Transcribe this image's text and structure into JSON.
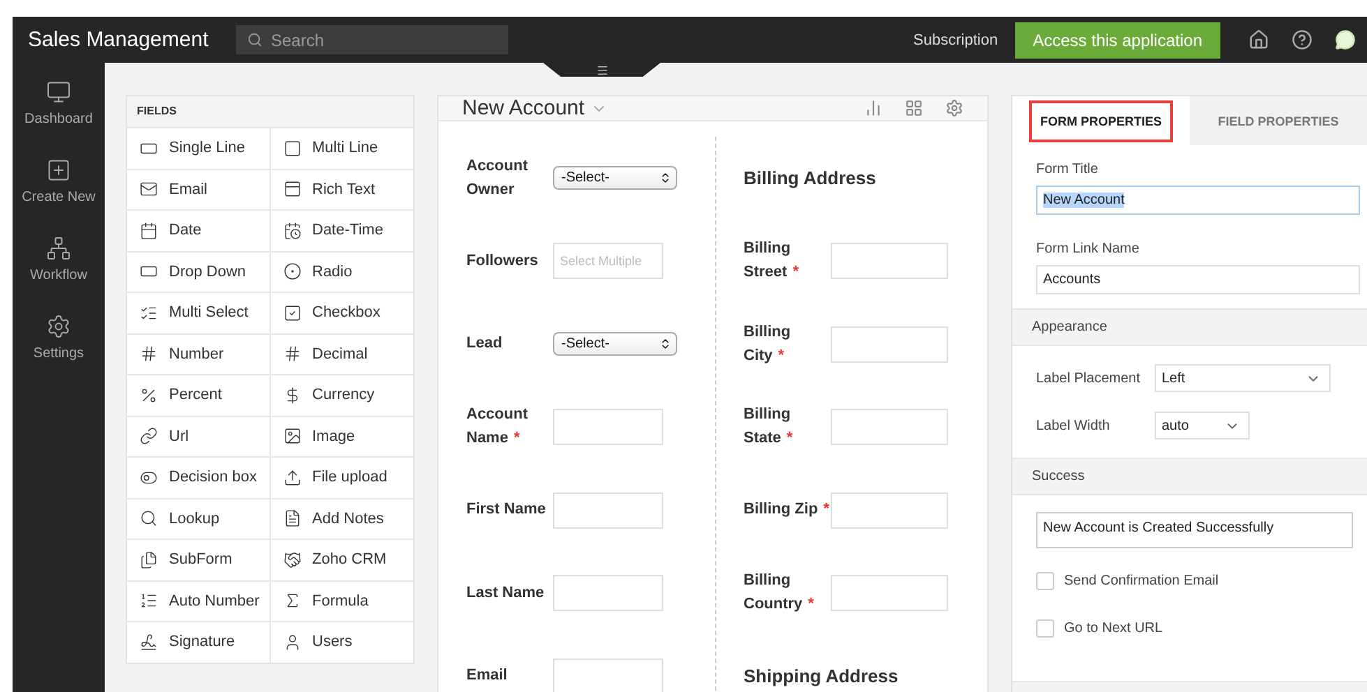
{
  "app": {
    "title": "Sales Management",
    "search_placeholder": "Search",
    "subscription": "Subscription",
    "access_button": "Access this application"
  },
  "sidebar": {
    "items": [
      {
        "label": "Dashboard"
      },
      {
        "label": "Create New"
      },
      {
        "label": "Workflow"
      },
      {
        "label": "Settings"
      }
    ]
  },
  "fields_panel": {
    "title": "FIELDS",
    "items": [
      "Single Line",
      "Multi Line",
      "Email",
      "Rich Text",
      "Date",
      "Date-Time",
      "Drop Down",
      "Radio",
      "Multi Select",
      "Checkbox",
      "Number",
      "Decimal",
      "Percent",
      "Currency",
      "Url",
      "Image",
      "Decision box",
      "File upload",
      "Lookup",
      "Add Notes",
      "SubForm",
      "Zoho CRM",
      "Auto Number",
      "Formula",
      "Signature",
      "Users"
    ]
  },
  "form": {
    "title": "New Account",
    "left": [
      {
        "kind": "select",
        "label": "Account Owner",
        "value": "-Select-"
      },
      {
        "kind": "multi",
        "label": "Followers",
        "placeholder": "Select Multiple"
      },
      {
        "kind": "select",
        "label": "Lead",
        "value": "-Select-"
      },
      {
        "kind": "input",
        "label": "Account Name",
        "required_mark": "*"
      },
      {
        "kind": "input",
        "label": "First Name"
      },
      {
        "kind": "input",
        "label": "Last Name"
      },
      {
        "kind": "input",
        "label": "Email"
      }
    ],
    "right": [
      {
        "kind": "heading",
        "label": "Billing Address"
      },
      {
        "kind": "input",
        "label": "Billing Street",
        "required_mark": "*"
      },
      {
        "kind": "input",
        "label": "Billing City",
        "required_mark": "*"
      },
      {
        "kind": "input",
        "label": "Billing State",
        "required_mark": "*"
      },
      {
        "kind": "input",
        "label": "Billing Zip",
        "required_mark": "*"
      },
      {
        "kind": "input",
        "label": "Billing Country",
        "required_mark": "*"
      },
      {
        "kind": "heading",
        "label": "Shipping Address"
      }
    ]
  },
  "properties": {
    "tabs": [
      {
        "label": "FORM PROPERTIES",
        "selected": true,
        "highlighted": true
      },
      {
        "label": "FIELD PROPERTIES",
        "selected": false,
        "highlighted": false
      }
    ],
    "form_title_label": "Form Title",
    "form_title": "New Account",
    "form_title_text_selected": true,
    "link_name_label": "Form Link Name",
    "link_name": "Accounts",
    "appearance": "Appearance",
    "label_placement_label": "Label Placement",
    "label_placement": "Left",
    "label_width_label": "Label Width",
    "label_width": "auto",
    "success": "Success",
    "success_message": "New Account is Created Successfully",
    "checkboxes": [
      {
        "label": "Send Confirmation Email",
        "checked": false
      },
      {
        "label": "Go to Next URL",
        "checked": false
      }
    ]
  }
}
